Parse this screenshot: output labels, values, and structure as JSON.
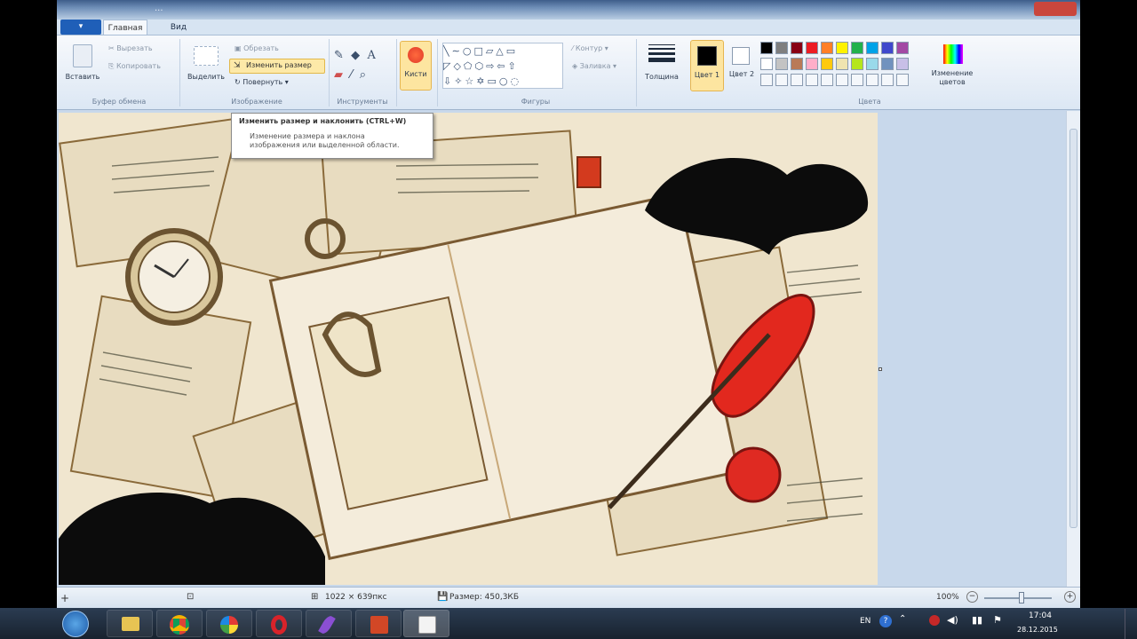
{
  "window": {
    "title": "..."
  },
  "tabs": {
    "menu": "▾",
    "home": "Главная",
    "view": "Вид"
  },
  "clipboard": {
    "paste": "Вставить",
    "cut": "Вырезать",
    "copy": "Копировать",
    "group": "Буфер обмена"
  },
  "image": {
    "select": "Выделить",
    "crop": "Обрезать",
    "resize": "Изменить размер",
    "rotate": "Повернуть ▾",
    "group": "Изображение"
  },
  "tools": {
    "group": "Инструменты"
  },
  "brushes": {
    "label": "Кисти"
  },
  "shapes": {
    "outline": "Контур ▾",
    "fill": "Заливка ▾",
    "group": "Фигуры"
  },
  "size": {
    "label": "Толщина"
  },
  "colors": {
    "color1": "Цвет 1",
    "color2": "Цвет 2",
    "edit": "Изменение цветов",
    "group": "Цвета",
    "palette_row1": [
      "#000000",
      "#7f7f7f",
      "#880015",
      "#ed1c24",
      "#ff7f27",
      "#fff200",
      "#22b14c",
      "#00a2e8",
      "#3f48cc",
      "#a349a4"
    ],
    "palette_row2": [
      "#ffffff",
      "#c3c3c3",
      "#b97a57",
      "#ffaec9",
      "#ffc90e",
      "#efe4b0",
      "#b5e61d",
      "#99d9ea",
      "#7092be",
      "#c8bfe7"
    ]
  },
  "tooltip": {
    "title": "Изменить размер и наклонить (CTRL+W)",
    "line1": "Изменение размера и наклона",
    "line2": "изображения или выделенной области."
  },
  "status": {
    "dimensions": "1022 × 639пкс",
    "filesize": "Размер: 450,3КБ",
    "zoom": "100%"
  },
  "tray": {
    "lang": "EN",
    "time": "17:04",
    "date": "28.12.2015"
  }
}
